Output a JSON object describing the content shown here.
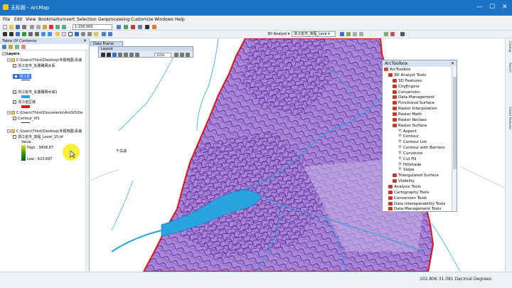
{
  "window": {
    "title": "无标题 - ArcMap",
    "minimize": "—",
    "maximize": "☐",
    "close": "✕"
  },
  "menu": [
    "File",
    "Edit",
    "View",
    "Bookmarks",
    "Insert",
    "Selection",
    "Geoprocessing",
    "Customize",
    "Windows",
    "Help"
  ],
  "toolbar": {
    "scale": "1:150,000",
    "analyst_label": "3D Analyst ▾",
    "layer_combo": "浙江省市_高程_Leve ▾"
  },
  "toc": {
    "title": "Table Of Contents",
    "layers_label": "Layers",
    "groups": [
      {
        "path": "C:\\Users\\Think\\Desktop\\专题地图\\青浦",
        "layer": "浙江省市_矢量路网水系"
      },
      {
        "path": "",
        "layer": "浙江省"
      },
      {
        "path": "",
        "layer": "浙江省市_矢量路网水域1"
      },
      {
        "path": "",
        "layer": "浙江省区域"
      },
      {
        "path": "C:\\Users\\Think\\Documents\\ArcGIS\\De",
        "layer": "Contour_tif1"
      },
      {
        "path": "C:\\Users\\Think\\Desktop\\专题地图\\青浦",
        "layer": "浙江省市_高程_Level_15.tif"
      }
    ],
    "legend": {
      "value_label": "Value",
      "high": "High : 3458.87",
      "low": "Low : 623.697"
    }
  },
  "floating": {
    "data_frame": "Data Frame",
    "layout": "Layout",
    "layout_zoom": "110%"
  },
  "arctoolbox": {
    "title": "ArcToolbox",
    "root": "ArcToolbox",
    "items": [
      {
        "label": "3D Analyst Tools",
        "level": 1,
        "kind": "box",
        "expanded": true
      },
      {
        "label": "3D Features",
        "level": 2,
        "kind": "box"
      },
      {
        "label": "CityEngine",
        "level": 2,
        "kind": "box"
      },
      {
        "label": "Conversion",
        "level": 2,
        "kind": "box"
      },
      {
        "label": "Data Management",
        "level": 2,
        "kind": "box"
      },
      {
        "label": "Functional Surface",
        "level": 2,
        "kind": "box"
      },
      {
        "label": "Raster Interpolation",
        "level": 2,
        "kind": "box"
      },
      {
        "label": "Raster Math",
        "level": 2,
        "kind": "box"
      },
      {
        "label": "Raster Reclass",
        "level": 2,
        "kind": "box"
      },
      {
        "label": "Raster Surface",
        "level": 2,
        "kind": "box",
        "expanded": true
      },
      {
        "label": "Aspect",
        "level": 3,
        "kind": "tool"
      },
      {
        "label": "Contour",
        "level": 3,
        "kind": "tool"
      },
      {
        "label": "Contour List",
        "level": 3,
        "kind": "tool"
      },
      {
        "label": "Contour with Barriers",
        "level": 3,
        "kind": "tool"
      },
      {
        "label": "Curvature",
        "level": 3,
        "kind": "tool"
      },
      {
        "label": "Cut Fill",
        "level": 3,
        "kind": "tool"
      },
      {
        "label": "Hillshade",
        "level": 3,
        "kind": "tool"
      },
      {
        "label": "Slope",
        "level": 3,
        "kind": "tool"
      },
      {
        "label": "Triangulated Surface",
        "level": 2,
        "kind": "box"
      },
      {
        "label": "Visibility",
        "level": 2,
        "kind": "box"
      },
      {
        "label": "Analysis Tools",
        "level": 1,
        "kind": "box"
      },
      {
        "label": "Cartography Tools",
        "level": 1,
        "kind": "box"
      },
      {
        "label": "Conversion Tools",
        "level": 1,
        "kind": "box"
      },
      {
        "label": "Data Interoperability Tools",
        "level": 1,
        "kind": "box"
      },
      {
        "label": "Data Management Tools",
        "level": 1,
        "kind": "box"
      }
    ]
  },
  "right_panels": [
    "Catalog",
    "Search",
    "Create Features"
  ],
  "map_labels": [
    "千岛湖"
  ],
  "status": {
    "coords": "102.806 31.081 Decimal Degrees"
  },
  "colors": {
    "titlebar": "#1c73c4",
    "contour_fill": "#a787d6",
    "contour_line": "#5c1e9c",
    "boundary": "#e01b1b",
    "water": "#2aa3e0"
  }
}
